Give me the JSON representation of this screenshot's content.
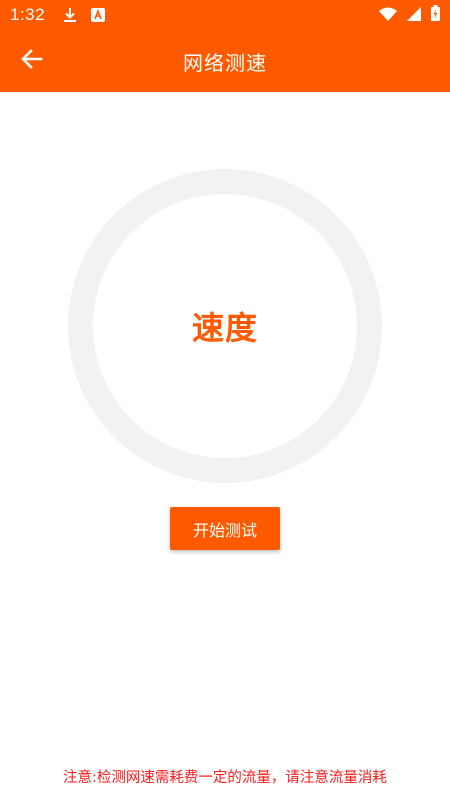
{
  "status_bar": {
    "time": "1:32",
    "icons": [
      "download-icon",
      "app-a-icon",
      "wifi-icon",
      "signal-icon",
      "battery-charging-icon"
    ]
  },
  "app_bar": {
    "title": "网络测速",
    "back_icon": "arrow-left-icon"
  },
  "gauge": {
    "label": "速度"
  },
  "start_button": {
    "label": "开始测试"
  },
  "notice": {
    "text": "注意:检测网速需耗费一定的流量，请注意流量消耗"
  },
  "colors": {
    "accent": "#ff5a00",
    "ring": "#f2f2f2",
    "notice": "#ff1a1a",
    "background": "#ffffff"
  }
}
